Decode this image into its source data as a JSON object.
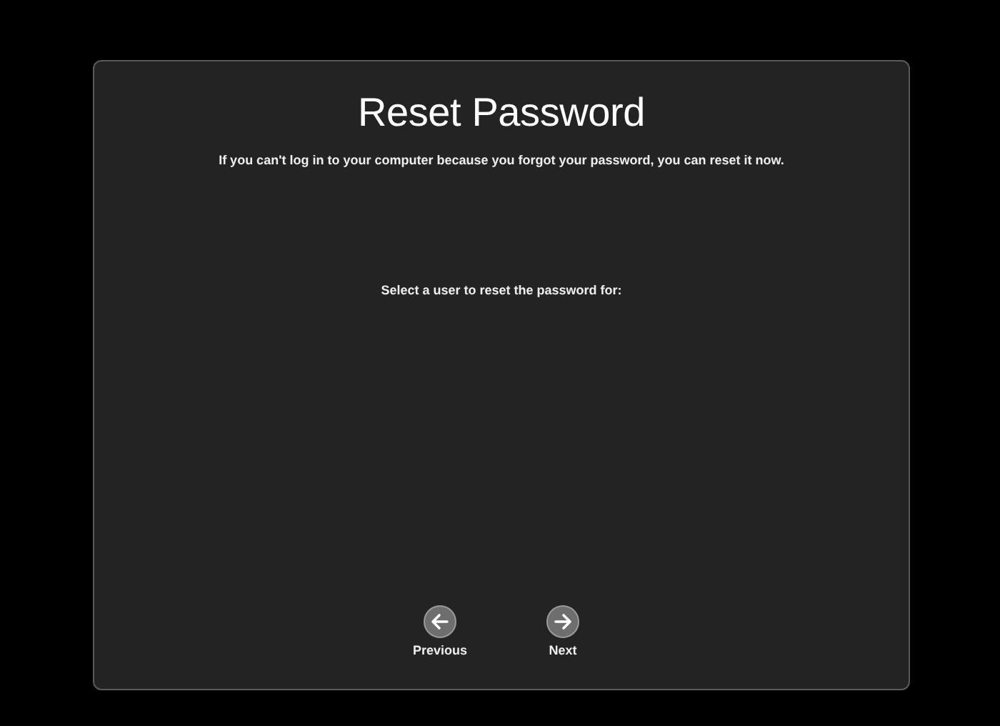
{
  "title": "Reset Password",
  "description": "If you can't log in to your computer because you forgot your password, you can reset it now.",
  "prompt": "Select a user to reset the password for:",
  "buttons": [
    {
      "label": "Previous",
      "kind": "back"
    },
    {
      "label": "Next",
      "kind": "forward"
    }
  ]
}
